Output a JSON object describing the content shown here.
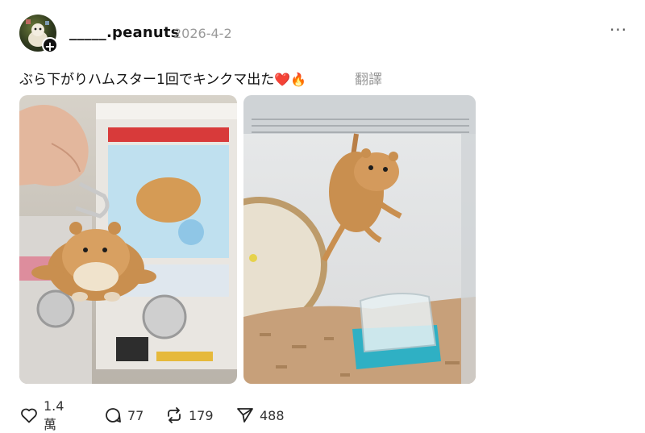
{
  "post": {
    "username": "_____.peanuts",
    "timestamp": "2026-4-2",
    "more_label": "···",
    "caption": "ぶら下がりハムスター1回でキンクマ出た",
    "caption_emojis": "❤️🔥",
    "translate_label": "翻譯"
  },
  "actions": {
    "likes": "1.4 萬",
    "comments": "77",
    "reposts": "179",
    "shares": "488"
  },
  "icons": {
    "like": "heart-icon",
    "comment": "comment-bubble-icon",
    "repost": "repost-icon",
    "share": "send-icon",
    "follow": "plus-icon",
    "more": "more-options-icon"
  },
  "colors": {
    "text": "#111111",
    "muted": "#9a9a9a",
    "hamster": "#c98f4f"
  }
}
